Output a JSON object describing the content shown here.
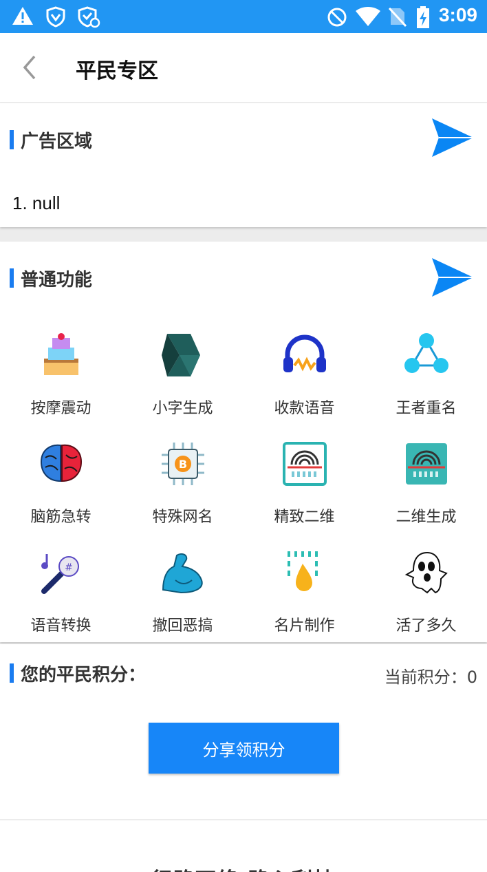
{
  "status_bar": {
    "time": "3:09",
    "icons": [
      "alert-icon",
      "vpn-shield-icon",
      "shield-settings-icon",
      "do-not-disturb-icon",
      "wifi-icon",
      "no-sim-icon",
      "battery-charging-icon"
    ]
  },
  "header": {
    "title": "平民专区",
    "back_icon": "chevron-left-icon"
  },
  "ad_section": {
    "title": "广告区域",
    "items": [
      "1.  null"
    ]
  },
  "features_section": {
    "title": "普通功能",
    "items": [
      {
        "label": "按摩震动",
        "icon": "cake-icon"
      },
      {
        "label": "小字生成",
        "icon": "3d-logo-icon"
      },
      {
        "label": "收款语音",
        "icon": "headphones-icon"
      },
      {
        "label": "王者重名",
        "icon": "share-nodes-icon"
      },
      {
        "label": "脑筋急转",
        "icon": "brain-icon"
      },
      {
        "label": "特殊网名",
        "icon": "bitcoin-chip-icon"
      },
      {
        "label": "精致二维",
        "icon": "fingerprint-scan-icon"
      },
      {
        "label": "二维生成",
        "icon": "fingerprint-scan-filled-icon"
      },
      {
        "label": "语音转换",
        "icon": "microphone-icon"
      },
      {
        "label": "撤回恶搞",
        "icon": "muscle-arm-icon"
      },
      {
        "label": "名片制作",
        "icon": "shower-drop-icon"
      },
      {
        "label": "活了多久",
        "icon": "ghost-icon"
      }
    ]
  },
  "points": {
    "title": "您的平民积分：",
    "current": "当前积分：0",
    "share_button": "分享领积分"
  },
  "footer": {
    "slogan": "行路可终 路心利持"
  },
  "colors": {
    "status_bar": "#2196f3",
    "accent": "#1a7cf0",
    "button": "#1786f8"
  }
}
